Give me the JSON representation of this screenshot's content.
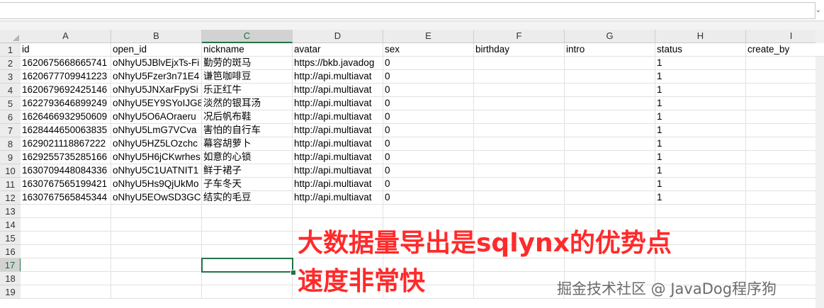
{
  "formula_bar": {
    "value": ""
  },
  "columns": [
    "A",
    "B",
    "C",
    "D",
    "E",
    "F",
    "G",
    "H",
    "I"
  ],
  "selected_column": "C",
  "selected_row": 17,
  "row_numbers": [
    "1",
    "2",
    "3",
    "4",
    "5",
    "6",
    "7",
    "8",
    "9",
    "10",
    "11",
    "12",
    "13",
    "14",
    "15",
    "16",
    "17",
    "18",
    "19"
  ],
  "headers": [
    "id",
    "open_id",
    "nickname",
    "avatar",
    "sex",
    "birthday",
    "intro",
    "status",
    "create_by"
  ],
  "rows": [
    [
      "1620675668665741",
      "oNhyU5JBlvEjxTs-Fi",
      "勤劳的斑马",
      "https://bkb.javadog",
      "0",
      "",
      "",
      "1",
      ""
    ],
    [
      "1620677709941223",
      "oNhyU5Fzer3n71E4",
      "谦笆咖啡豆",
      "http://api.multiavat",
      "0",
      "",
      "",
      "1",
      ""
    ],
    [
      "1620679692425146",
      "oNhyU5JNXarFpySi",
      "乐正红牛",
      "http://api.multiavat",
      "0",
      "",
      "",
      "1",
      ""
    ],
    [
      "1622793646899249",
      "oNhyU5EY9SYoIJG8",
      "淡然的银耳汤",
      "http://api.multiavat",
      "0",
      "",
      "",
      "1",
      ""
    ],
    [
      "1626466932950609",
      "oNhyU5O6AOraeru",
      "况后帆布鞋",
      "http://api.multiavat",
      "0",
      "",
      "",
      "1",
      ""
    ],
    [
      "1628444650063835",
      "oNhyU5LmG7VCva",
      "害怕的自行车",
      "http://api.multiavat",
      "0",
      "",
      "",
      "1",
      ""
    ],
    [
      "1629021118867222",
      "oNhyU5HZ5LOzchc",
      "幕容胡萝卜",
      "http://api.multiavat",
      "0",
      "",
      "",
      "1",
      ""
    ],
    [
      "1629255735285166",
      "oNhyU5H6jCKwrhes",
      "如意的心锁",
      "http://api.multiavat",
      "0",
      "",
      "",
      "1",
      ""
    ],
    [
      "1630709448084336",
      "oNhyU5C1UATNIT1",
      "鲜于裙子",
      "http://api.multiavat",
      "0",
      "",
      "",
      "1",
      ""
    ],
    [
      "1630767565199421",
      "oNhyU5Hs9QjUkMo",
      "子车冬天",
      "http://api.multiavat",
      "0",
      "",
      "",
      "1",
      ""
    ],
    [
      "1630767565845344",
      "oNhyU5EOwSD3GC",
      "结实的毛豆",
      "http://api.multiavat",
      "0",
      "",
      "",
      "1",
      ""
    ]
  ],
  "annotation": {
    "line1": "大数据量导出是sqlynx的优势点",
    "line2": "速度非常快"
  },
  "watermark": "掘金技术社区 @ JavaDog程序狗"
}
